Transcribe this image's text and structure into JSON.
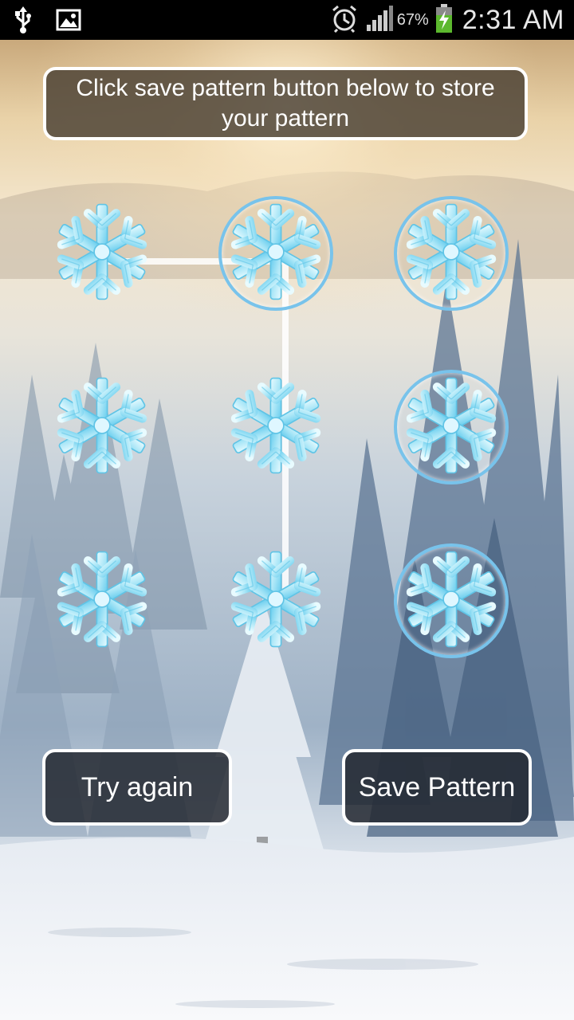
{
  "status_bar": {
    "icons_left": [
      "usb-icon",
      "image-icon"
    ],
    "icons_right": [
      "alarm-icon",
      "signal-icon",
      "battery-charging-icon"
    ],
    "battery_percent": "67%",
    "time": "2:31 AM"
  },
  "banner": {
    "text": "Click save pattern button below to store your pattern"
  },
  "pattern": {
    "grid_size": 3,
    "selected_nodes": [
      1,
      2,
      5,
      8
    ],
    "node_icon": "snowflake-icon",
    "ring_color": "#78c3eb"
  },
  "buttons": {
    "try_again": "Try again",
    "save_pattern": "Save Pattern"
  },
  "colors": {
    "banner_bg": "#483e32",
    "button_bg": "#232830",
    "border": "#ffffff"
  }
}
